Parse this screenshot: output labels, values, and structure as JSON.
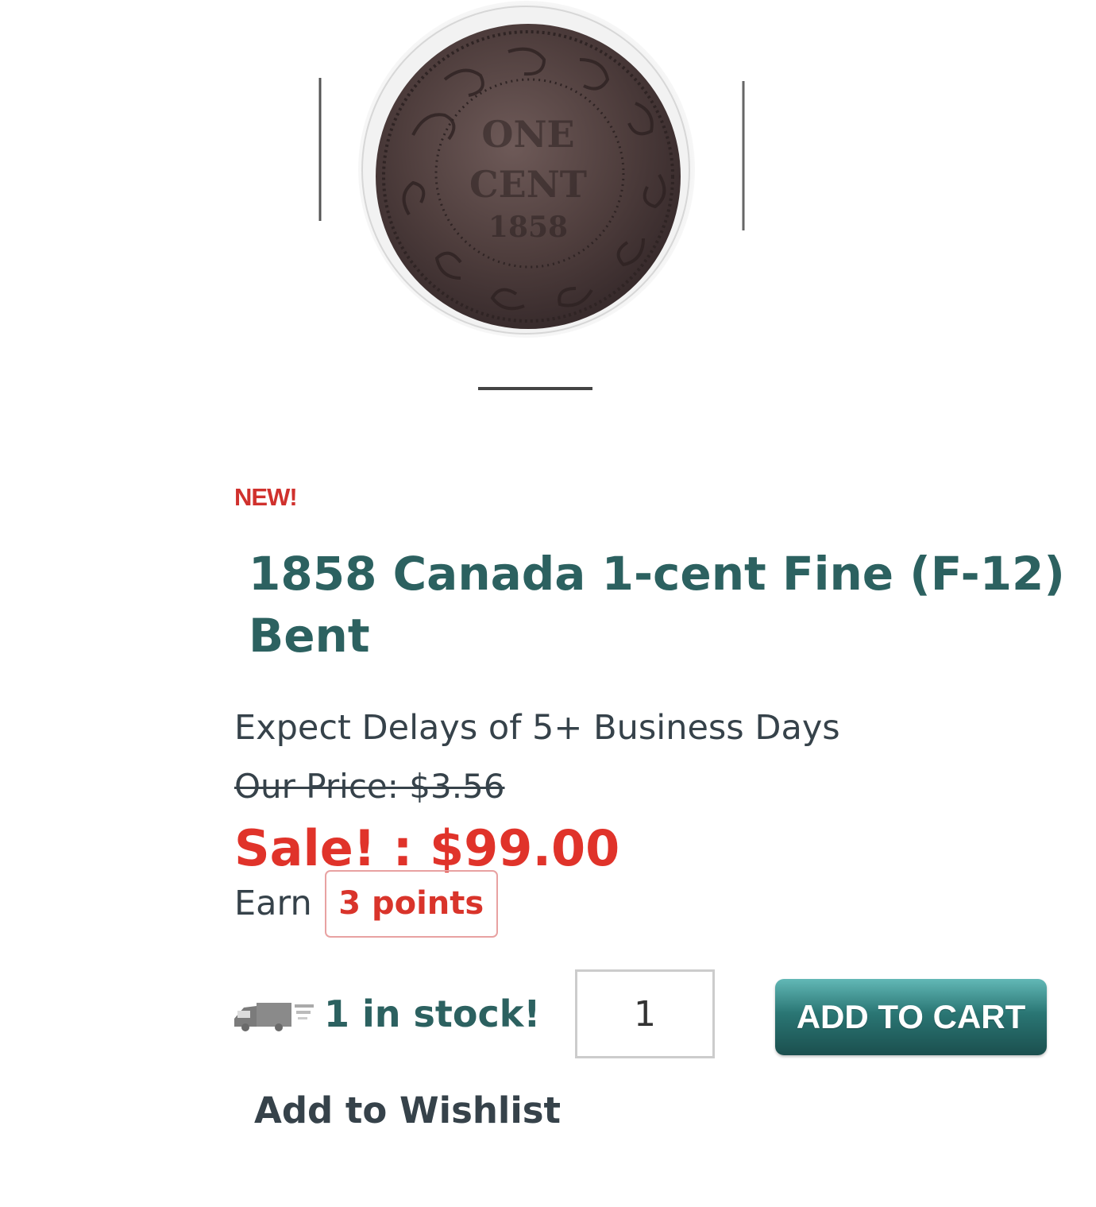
{
  "product": {
    "image_alt": "1858 Canada 1-cent coin",
    "badge": "NEW!",
    "title": "1858 Canada 1-cent Fine (F-12) Bent",
    "delay_notice": "Expect Delays of 5+ Business Days",
    "our_price": "Our Price: $3.56",
    "sale_price": "Sale! : $99.00",
    "earn_label": "Earn",
    "points": "3 points",
    "stock_status": "1 in stock!",
    "quantity": "1",
    "add_to_cart_label": "ADD TO CART",
    "wishlist_label": "Add to Wishlist"
  },
  "coin_legend": {
    "line1": "ONE",
    "line2": "CENT",
    "line3": "1858"
  },
  "colors": {
    "accent_teal": "#2c6160",
    "sale_red": "#e0332a",
    "badge_red": "#d0312d",
    "text_dark": "#36424a"
  },
  "icons": {
    "truck": "truck-icon"
  }
}
